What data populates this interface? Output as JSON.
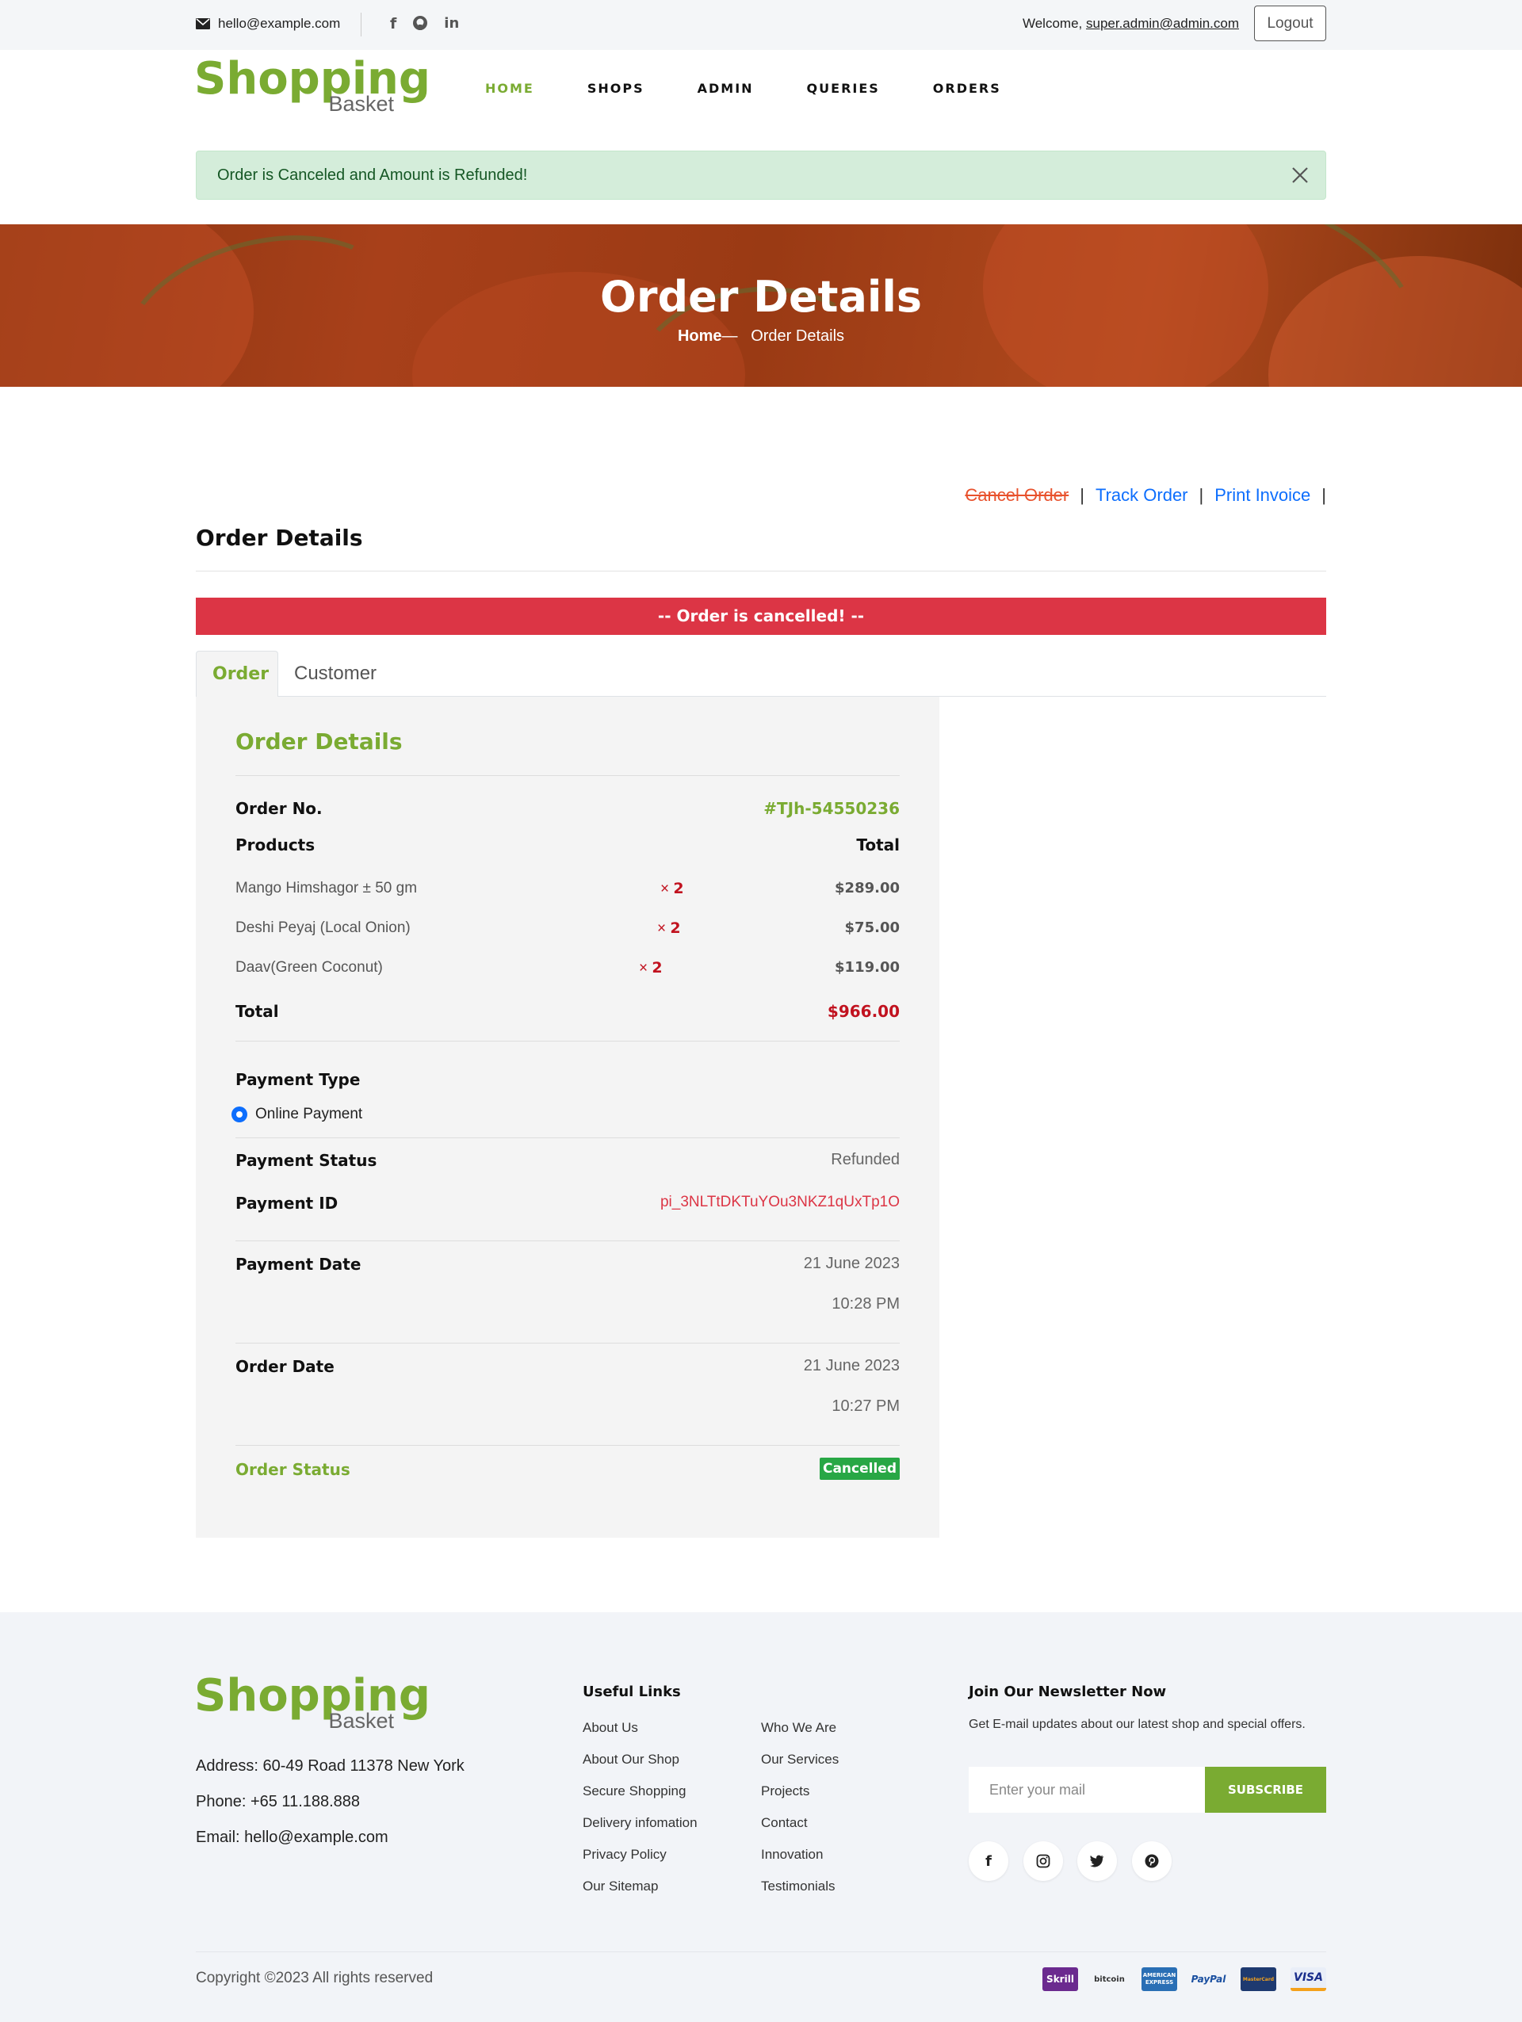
{
  "topbar": {
    "email": "hello@example.com",
    "welcome_prefix": "Welcome, ",
    "welcome_user": "super.admin@admin.com",
    "logout_label": "Logout",
    "social_icons": [
      "facebook-icon",
      "github-icon",
      "linkedin-icon"
    ]
  },
  "header": {
    "logo_main": "Shopping",
    "logo_sub": "Basket",
    "nav": [
      {
        "label": "HOME",
        "active": true
      },
      {
        "label": "SHOPS",
        "active": false
      },
      {
        "label": "ADMIN",
        "active": false
      },
      {
        "label": "QUERIES",
        "active": false
      },
      {
        "label": "ORDERS",
        "active": false
      }
    ]
  },
  "alert": {
    "message": "Order is Canceled and Amount is Refunded!"
  },
  "banner": {
    "title": "Order Details",
    "crumb_home": "Home",
    "crumb_sep": "—",
    "crumb_current": "Order Details"
  },
  "actions": {
    "cancel_order": "Cancel Order",
    "track_order": "Track Order",
    "print_invoice": "Print Invoice",
    "separator": "|"
  },
  "main": {
    "section_title": "Order Details",
    "cancel_notice": "-- Order is cancelled! --",
    "tabs": [
      {
        "label": "Order",
        "active": true
      },
      {
        "label": "Customer",
        "active": false
      }
    ]
  },
  "order": {
    "panel_title": "Order Details",
    "order_no_label": "Order No.",
    "order_no": "#TJh-54550236",
    "products_label": "Products",
    "total_col_label": "Total",
    "items": [
      {
        "name": "Mango Himshagor ± 50 gm",
        "times": "×",
        "qty": "2",
        "price": "$289.00"
      },
      {
        "name": "Deshi Peyaj (Local Onion)",
        "times": "×",
        "qty": "2",
        "price": "$75.00"
      },
      {
        "name": "Daav(Green Coconut)",
        "times": "×",
        "qty": "2",
        "price": "$119.00"
      }
    ],
    "total_label": "Total",
    "total_value": "$966.00",
    "payment_type_label": "Payment Type",
    "payment_type": "Online Payment",
    "payment_status_label": "Payment Status",
    "payment_status": "Refunded",
    "payment_id_label": "Payment ID",
    "payment_id": "pi_3NLTtDKTuYOu3NKZ1qUxTp1O",
    "payment_date_label": "Payment Date",
    "payment_date": "21 June 2023",
    "payment_time": "10:28 PM",
    "order_date_label": "Order Date",
    "order_date": "21 June 2023",
    "order_time": "10:27 PM",
    "order_status_label": "Order Status",
    "order_status": "Cancelled"
  },
  "footer": {
    "logo_main": "Shopping",
    "logo_sub": "Basket",
    "address": "Address: 60-49 Road 11378 New York",
    "phone": "Phone: +65 11.188.888",
    "email": "Email: hello@example.com",
    "useful_links_title": "Useful Links",
    "links_col1": [
      "About Us",
      "About Our Shop",
      "Secure Shopping",
      "Delivery infomation",
      "Privacy Policy",
      "Our Sitemap"
    ],
    "links_col2": [
      "Who We Are",
      "Our Services",
      "Projects",
      "Contact",
      "Innovation",
      "Testimonials"
    ],
    "newsletter_title": "Join Our Newsletter Now",
    "newsletter_text": "Get E-mail updates about our latest shop and special offers.",
    "newsletter_placeholder": "Enter your mail",
    "subscribe_label": "SUBSCRIBE",
    "social_icons": [
      "facebook-icon",
      "instagram-icon",
      "twitter-icon",
      "pinterest-icon"
    ],
    "copyright": "Copyright ©2023 All rights reserved",
    "payment_methods": [
      "Skrill",
      "bitcoin",
      "AMERICAN EXPRESS",
      "PayPal",
      "MasterCard",
      "VISA"
    ]
  },
  "colors": {
    "brand_green": "#7aab32",
    "danger_red": "#dc3545",
    "price_red": "#c1121f",
    "link_blue": "#0d6efd",
    "success_green": "#28a745",
    "alert_bg": "#d4edda"
  }
}
